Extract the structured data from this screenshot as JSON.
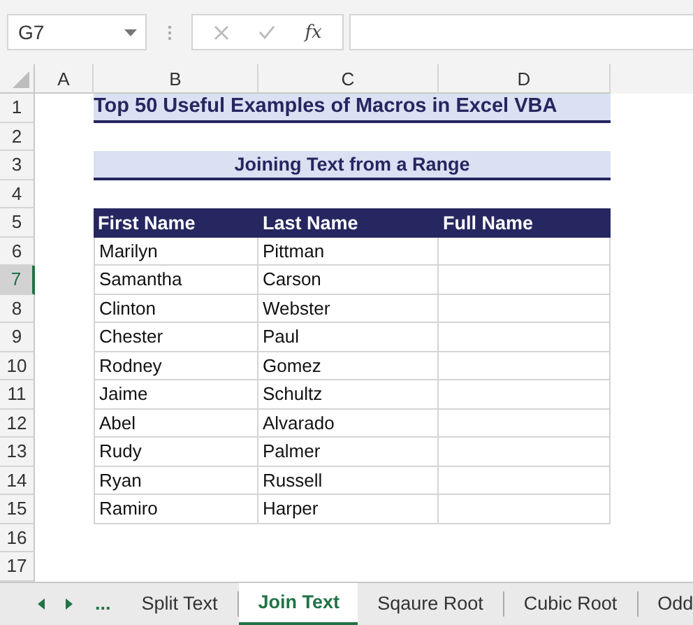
{
  "formula_bar": {
    "name_box": "G7",
    "function_label": "fx"
  },
  "column_headers": [
    "A",
    "B",
    "C",
    "D"
  ],
  "row_headers": [
    {
      "label": "1",
      "selected": false
    },
    {
      "label": "2",
      "selected": false
    },
    {
      "label": "3",
      "selected": false
    },
    {
      "label": "4",
      "selected": false
    },
    {
      "label": "5",
      "selected": false
    },
    {
      "label": "6",
      "selected": false
    },
    {
      "label": "7",
      "selected": true
    },
    {
      "label": "8",
      "selected": false
    },
    {
      "label": "9",
      "selected": false
    },
    {
      "label": "10",
      "selected": false
    },
    {
      "label": "11",
      "selected": false
    },
    {
      "label": "12",
      "selected": false
    },
    {
      "label": "13",
      "selected": false
    },
    {
      "label": "14",
      "selected": false
    },
    {
      "label": "15",
      "selected": false
    },
    {
      "label": "16",
      "selected": false
    },
    {
      "label": "17",
      "selected": false
    }
  ],
  "title": "Top 50 Useful Examples of Macros in Excel VBA",
  "subtitle": "Joining Text from a Range",
  "table": {
    "columns": [
      "First Name",
      "Last Name",
      "Full Name"
    ],
    "rows": [
      [
        "Marilyn",
        "Pittman",
        ""
      ],
      [
        "Samantha",
        "Carson",
        ""
      ],
      [
        "Clinton",
        "Webster",
        ""
      ],
      [
        "Chester",
        "Paul",
        ""
      ],
      [
        "Rodney",
        "Gomez",
        ""
      ],
      [
        "Jaime",
        "Schultz",
        ""
      ],
      [
        "Abel",
        "Alvarado",
        ""
      ],
      [
        "Rudy",
        "Palmer",
        ""
      ],
      [
        "Ryan",
        "Russell",
        ""
      ],
      [
        "Ramiro",
        "Harper",
        ""
      ]
    ]
  },
  "sheet_tabs": {
    "more": "...",
    "tabs": [
      {
        "label": "Split Text",
        "selected": false
      },
      {
        "label": "Join Text",
        "selected": true
      },
      {
        "label": "Sqaure Root",
        "selected": false
      },
      {
        "label": "Cubic Root",
        "selected": false
      },
      {
        "label": "Odd",
        "selected": false
      }
    ]
  }
}
